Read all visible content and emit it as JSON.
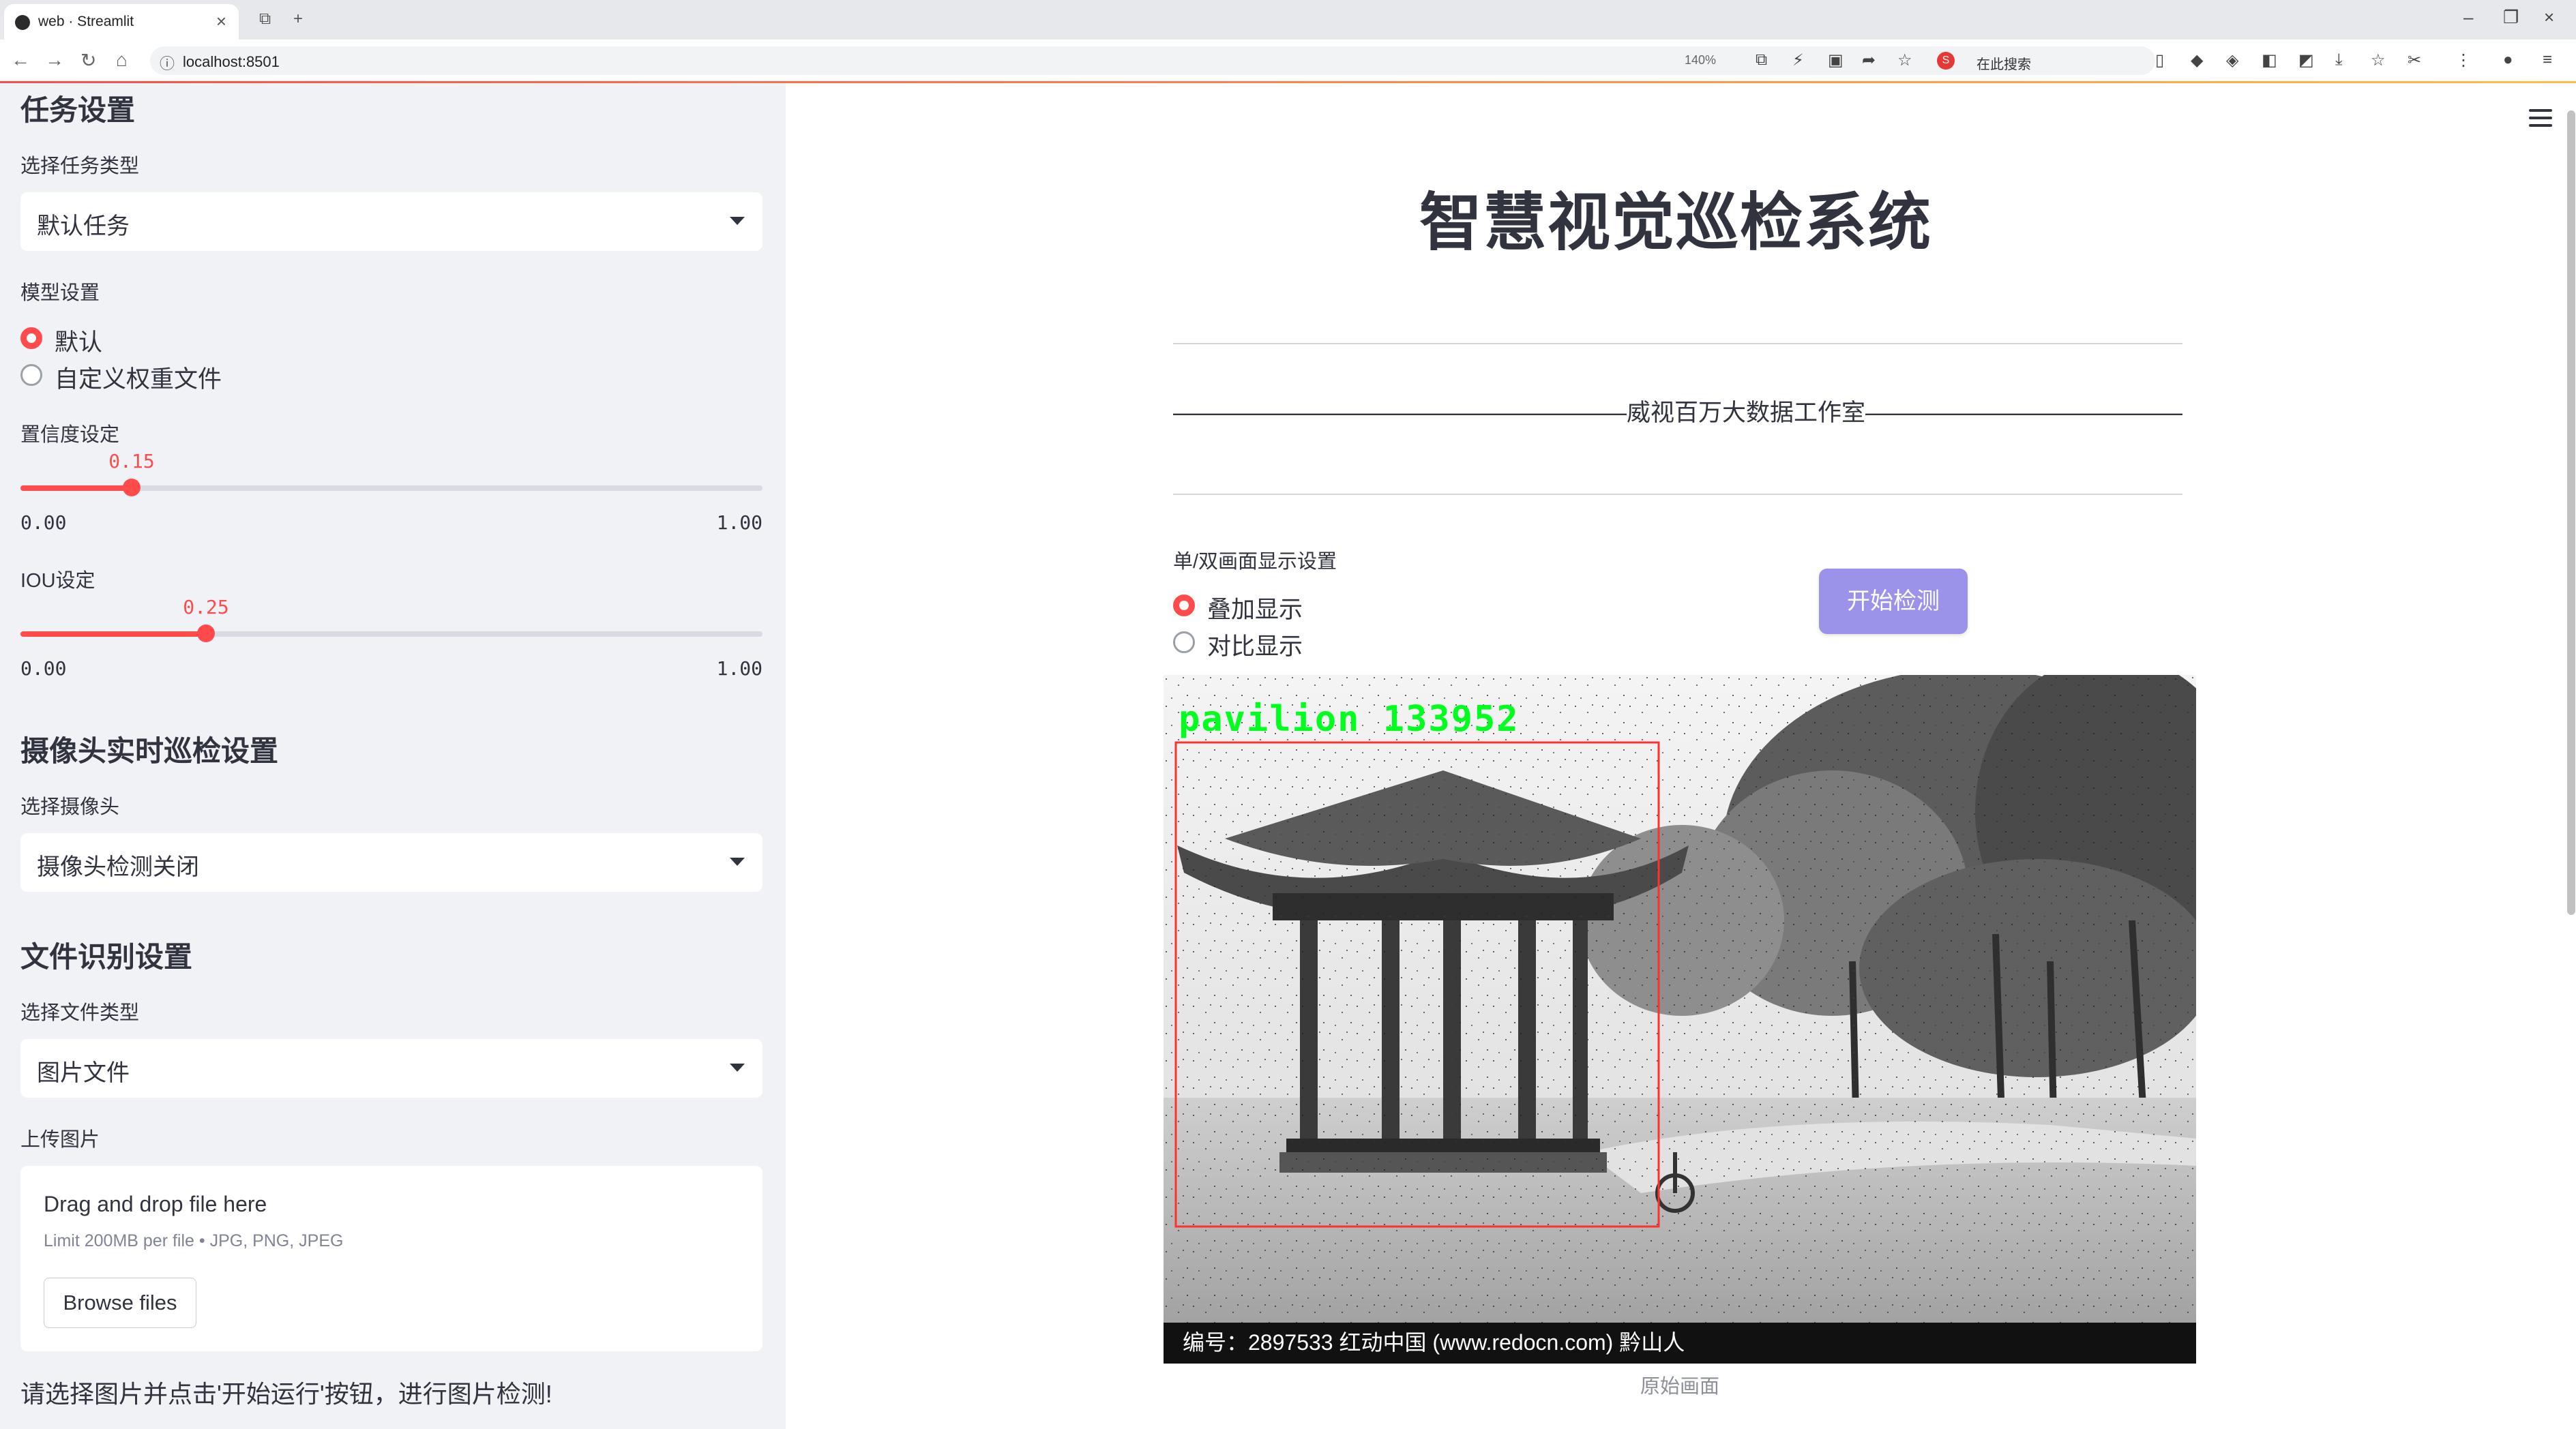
{
  "browser": {
    "tab_title": "web · Streamlit",
    "url": "localhost:8501",
    "zoom": "140%",
    "search_placeholder": "在此搜索"
  },
  "sidebar": {
    "task_section": {
      "heading": "任务设置",
      "task_type_label": "选择任务类型",
      "task_type_value": "默认任务"
    },
    "model_section": {
      "label": "模型设置",
      "options": [
        "默认",
        "自定义权重文件"
      ],
      "selected": "默认"
    },
    "confidence": {
      "label": "置信度设定",
      "value": 0.15,
      "value_text": "0.15",
      "min": "0.00",
      "max": "1.00"
    },
    "iou": {
      "label": "IOU设定",
      "value": 0.25,
      "value_text": "0.25",
      "min": "0.00",
      "max": "1.00"
    },
    "camera_section": {
      "heading": "摄像头实时巡检设置",
      "select_label": "选择摄像头",
      "select_value": "摄像头检测关闭"
    },
    "file_section": {
      "heading": "文件识别设置",
      "type_label": "选择文件类型",
      "type_value": "图片文件",
      "upload_label": "上传图片",
      "drag_text": "Drag and drop file here",
      "limit_text": "Limit 200MB per file • JPG, PNG, JPEG",
      "browse_label": "Browse files"
    },
    "note": "请选择图片并点击'开始运行'按钮，进行图片检测!"
  },
  "main": {
    "title": "智慧视觉巡检系统",
    "studio_line": "———————————————————威视百万大数据工作室—————————————————————",
    "display_label": "单/双画面显示设置",
    "display_options": [
      "叠加显示",
      "对比显示"
    ],
    "display_selected": "叠加显示",
    "start_button": "开始检测",
    "detection_label": "pavilion 133952",
    "watermark": "编号：2897533    红动中国 (www.redocn.com)    黔山人",
    "caption": "原始画面",
    "colors": {
      "accent": "#ff4b4b",
      "button": "#9b93ea",
      "detection_box": "#ff3030",
      "detection_text": "#00ff1e"
    }
  }
}
